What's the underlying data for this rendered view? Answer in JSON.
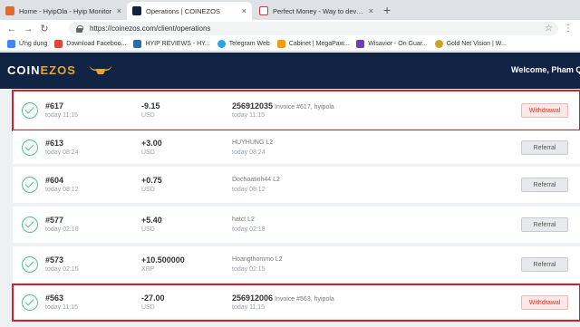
{
  "browser": {
    "tabs": [
      {
        "label": "Home - HyipOla - Hyip Monitor",
        "close": "×",
        "active": false,
        "icon_color": "#e06b2f"
      },
      {
        "label": "Operations | COINEZOS",
        "close": "×",
        "active": true,
        "icon_color": "#102343"
      },
      {
        "label": "Perfect Money - Way to develop",
        "close": "×",
        "active": false,
        "icon_color": "#d33"
      }
    ],
    "new_tab": "+",
    "url": "https://coinezos.com/client/operations",
    "bookmarks": [
      {
        "label": "Ứng dụng",
        "icon_color": "#4285f4"
      },
      {
        "label": "Download Faceboo...",
        "icon_color": "#e0463a"
      },
      {
        "label": "HYIP REVIEWS - HY...",
        "icon_color": "#2b6cb0"
      },
      {
        "label": "Telegram Web",
        "icon_color": "#2aa3de"
      },
      {
        "label": "Cabinet | MegaPaw...",
        "icon_color": "#f39c12"
      },
      {
        "label": "Wisavior - On Guar...",
        "icon_color": "#6c3fb5"
      },
      {
        "label": "Gold Net Vision | W...",
        "icon_color": "#c9a227"
      }
    ]
  },
  "site": {
    "logo_pre": "COIN",
    "logo_accent": "EZOS",
    "welcome": "Welcome, Pham Qu"
  },
  "operations": [
    {
      "id": "#617",
      "date": "today 11:15",
      "amount": "-9.15",
      "currency": "USD",
      "batch": "256912035",
      "desc": "Invoice #617, hyipola",
      "desc_date": "today 11:15",
      "button": "Withdrawal",
      "type": "withdraw",
      "highlighted": true
    },
    {
      "id": "#613",
      "date": "today 08:24",
      "amount": "+3.00",
      "currency": "USD",
      "batch": "",
      "desc": "HUYHUNG L2",
      "desc_date": "today 08:24",
      "button": "Referral",
      "type": "referral",
      "highlighted": false
    },
    {
      "id": "#604",
      "date": "today 08:12",
      "amount": "+0.75",
      "currency": "USD",
      "batch": "",
      "desc": "Dochoatinh44 L2",
      "desc_date": "today 08:12",
      "button": "Referral",
      "type": "referral",
      "highlighted": false
    },
    {
      "id": "#577",
      "date": "today 02:18",
      "amount": "+5.40",
      "currency": "USD",
      "batch": "",
      "desc": "hatct L2",
      "desc_date": "today 02:18",
      "button": "Referral",
      "type": "referral",
      "highlighted": false
    },
    {
      "id": "#573",
      "date": "today 02:15",
      "amount": "+10.500000",
      "currency": "XRP",
      "batch": "",
      "desc": "Hoangthommo L2",
      "desc_date": "today 02:15",
      "button": "Referral",
      "type": "referral",
      "highlighted": false
    },
    {
      "id": "#563",
      "date": "today 11:15",
      "amount": "-27.00",
      "currency": "USD",
      "batch": "256912006",
      "desc": "Invoice #563, hyipola",
      "desc_date": "today 11:15",
      "button": "Withdrawal",
      "type": "withdraw",
      "highlighted": true
    }
  ],
  "colors": {
    "header_bg": "#102343",
    "logo_accent": "#e8a430",
    "highlight": "#d61f26",
    "success": "#4cc48f"
  }
}
